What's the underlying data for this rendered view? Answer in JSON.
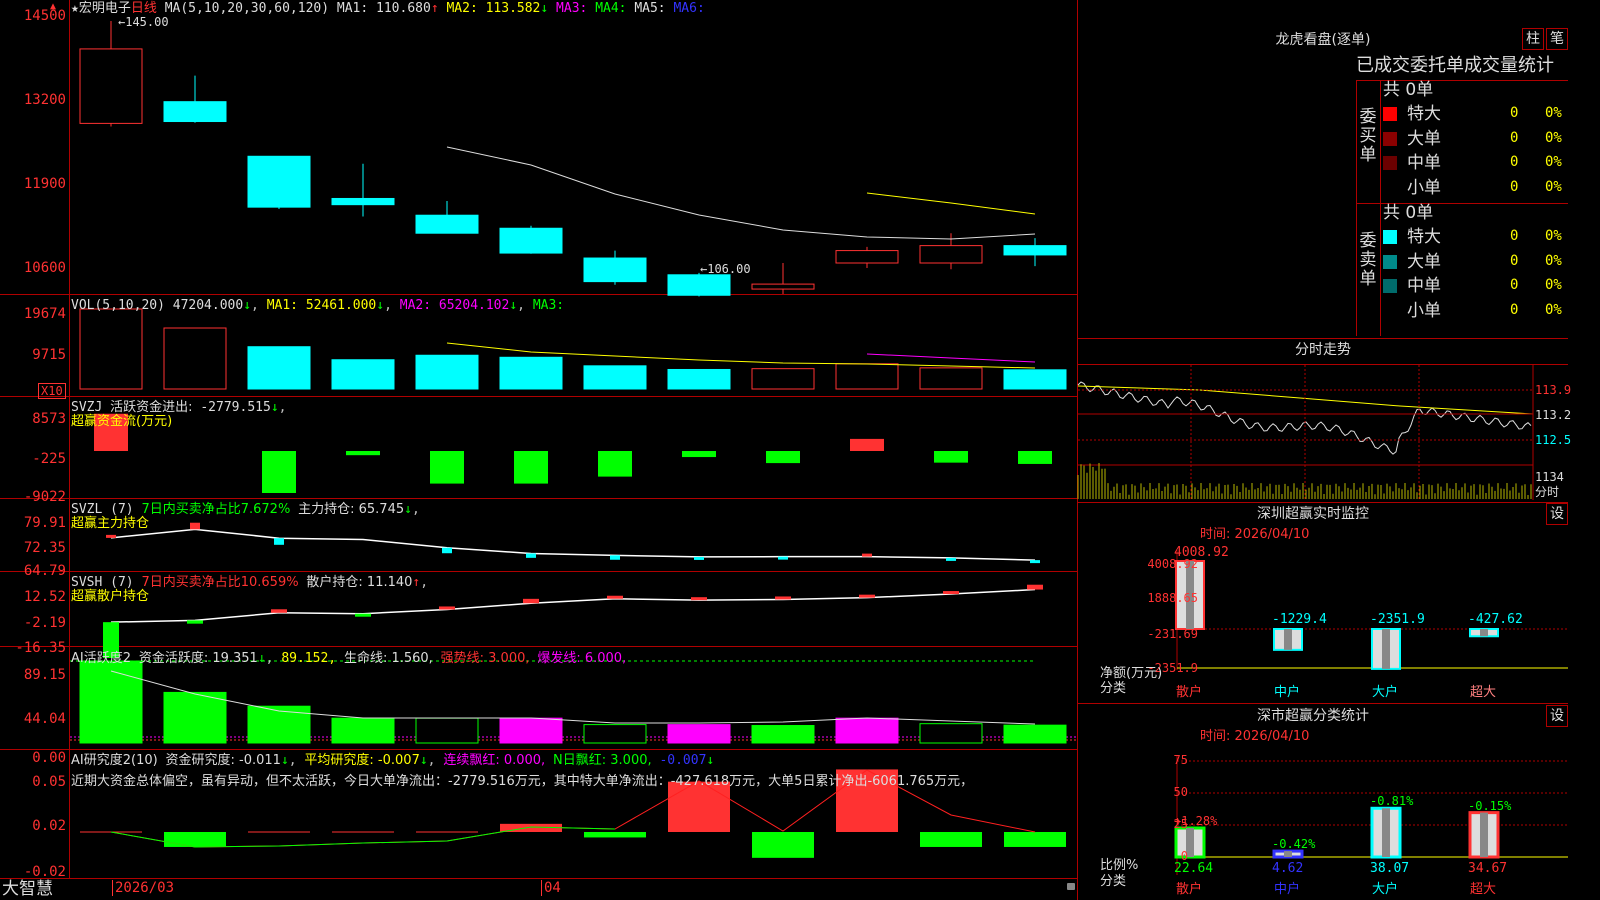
{
  "stock": {
    "star": "★",
    "name": "宏明电子",
    "period": "日线"
  },
  "kline": {
    "ma_label": "MA(5,10,20,30,60,120)",
    "ma1": "MA1: 110.680",
    "ma1_arrow": "↑",
    "ma2": "MA2: 113.582",
    "ma2_arrow": "↓",
    "ma3": "MA3:",
    "ma4": "MA4:",
    "ma5": "MA5:",
    "ma6": "MA6:",
    "high_marker": "145.00",
    "low_marker": "106.00",
    "y_labels": [
      "14500",
      "13200",
      "11900",
      "10600"
    ],
    "candles": [
      {
        "o": 128.5,
        "c": 140.5,
        "h": 145.0,
        "l": 128.0
      },
      {
        "o": 132.0,
        "c": 128.8,
        "h": 136.2,
        "l": 128.6
      },
      {
        "o": 123.2,
        "c": 115.0,
        "h": 123.2,
        "l": 114.7
      },
      {
        "o": 116.4,
        "c": 115.4,
        "h": 122.0,
        "l": 113.5
      },
      {
        "o": 113.7,
        "c": 110.8,
        "h": 116.0,
        "l": 110.8
      },
      {
        "o": 111.6,
        "c": 107.6,
        "h": 112.0,
        "l": 107.5
      },
      {
        "o": 106.8,
        "c": 103.0,
        "h": 108.0,
        "l": 102.5
      },
      {
        "o": 104.1,
        "c": 100.8,
        "h": 104.4,
        "l": 100.6
      },
      {
        "o": 101.8,
        "c": 102.6,
        "h": 106.0,
        "l": 101.0
      },
      {
        "o": 106.0,
        "c": 108.0,
        "h": 108.6,
        "l": 105.2
      },
      {
        "o": 106.0,
        "c": 108.8,
        "h": 110.8,
        "l": 105.0
      },
      {
        "o": 108.8,
        "c": 107.3,
        "h": 110.0,
        "l": 105.5
      }
    ]
  },
  "vol": {
    "label": "VOL(5,10,20)",
    "value": "47204.000",
    "value_arrow": "↓",
    "ma1": "MA1: 52461.000",
    "ma1_arrow": "↓",
    "ma2": "MA2: 65204.102",
    "ma2_arrow": "↓",
    "ma3": "MA3:",
    "y_labels": [
      "19674",
      "9715"
    ],
    "unit": "X10",
    "bars": [
      {
        "v": 19674,
        "up": false
      },
      {
        "v": 15000,
        "up": false
      },
      {
        "v": 10400,
        "up": true
      },
      {
        "v": 7200,
        "up": true
      },
      {
        "v": 8300,
        "up": true
      },
      {
        "v": 7800,
        "up": true
      },
      {
        "v": 5700,
        "up": true
      },
      {
        "v": 4800,
        "up": true
      },
      {
        "v": 5000,
        "up": false
      },
      {
        "v": 6200,
        "up": false
      },
      {
        "v": 5200,
        "up": false
      },
      {
        "v": 4720,
        "up": true
      }
    ]
  },
  "svzj": {
    "label": "SVZJ",
    "desc": "活跃资金进出:",
    "value": "-2779.515",
    "arrow": "↓",
    "sub": "超赢资金流(万元)",
    "y_labels": [
      "8573",
      "-225",
      "-9022"
    ],
    "values": [
      8000,
      0,
      -9022,
      -900,
      -7000,
      -7000,
      -5500,
      -1300,
      -2600,
      2600,
      -2500,
      -2779
    ]
  },
  "svzl": {
    "label": "SVZL",
    "period": "(7)",
    "desc": "7日内买卖净占比7.672%",
    "hold": "主力持仓: 65.745",
    "arrow": "↓",
    "sub": "超赢主力持仓",
    "y_labels": [
      "79.91",
      "72.35",
      "64.79"
    ],
    "line": [
      72.7,
      75.4,
      72.6,
      72.2,
      69.6,
      67.8,
      67.2,
      66.7,
      66.8,
      66.8,
      66.4,
      65.7
    ],
    "bars": [
      {
        "v": 0.4
      },
      {
        "v": 3.0
      },
      {
        "v": -3.0
      },
      {
        "v": 0
      },
      {
        "v": -2.5
      },
      {
        "v": -2.0
      },
      {
        "v": -2.0
      },
      {
        "v": -0.3
      },
      {
        "v": -0.5
      },
      {
        "v": 0.3
      },
      {
        "v": -0.4
      },
      {
        "v": -0.9
      }
    ]
  },
  "svsh": {
    "label": "SVSH",
    "period": "(7)",
    "desc": "7日内买卖净占比10.659%",
    "hold": "散户持仓: 11.140",
    "arrow": "↑",
    "sub": "超赢散户持仓",
    "y_labels": [
      "12.52",
      "-2.19",
      "-16.35"
    ],
    "line": [
      -7.0,
      -6.0,
      -1.8,
      -2.3,
      0.0,
      3.5,
      6.0,
      5.2,
      5.6,
      6.6,
      8.6,
      11.1
    ],
    "bars": [
      {
        "v": -16.3
      },
      {
        "v": -1.5
      },
      {
        "v": 1.6
      },
      {
        "v": -0.5
      },
      {
        "v": 1.4
      },
      {
        "v": 2.0
      },
      {
        "v": 1.3
      },
      {
        "v": 0.5
      },
      {
        "v": 0.3
      },
      {
        "v": 0.4
      },
      {
        "v": 1.0
      },
      {
        "v": 2.2
      }
    ]
  },
  "ai2": {
    "label": "AI活跃度2",
    "desc": "资金活跃度: 19.351",
    "arrow": "↓",
    "v2": "89.152,",
    "v3": "生命线: 1.560,",
    "v4": "强势线: 3.000,",
    "v5": "爆发线: 6.000,",
    "y_labels": [
      "89.15",
      "44.04",
      "0.00"
    ],
    "bars": [
      {
        "v": 89.1,
        "c": "g"
      },
      {
        "v": 55.0,
        "c": "g"
      },
      {
        "v": 40.0,
        "c": "g"
      },
      {
        "v": 27.0,
        "c": "g"
      },
      {
        "v": 27.0,
        "c": "go"
      },
      {
        "v": 27.0,
        "c": "m"
      },
      {
        "v": 20.0,
        "c": "go"
      },
      {
        "v": 20.0,
        "c": "m"
      },
      {
        "v": 19.0,
        "c": "g"
      },
      {
        "v": 27.0,
        "c": "m"
      },
      {
        "v": 21.0,
        "c": "go"
      },
      {
        "v": 19.4,
        "c": "g"
      }
    ]
  },
  "ai_research": {
    "label": "AI研究度2(10)",
    "desc": "资金研究度: -0.011",
    "arrow": "↓",
    "v2": "平均研究度: -0.007",
    "v2_arrow": "↓",
    "v3": "连续飘红: 0.000,",
    "v4": "N日飘红: 3.000,",
    "v5": "-0.007",
    "v5_arrow": "↓",
    "comment": "近期大资金总体偏空，虽有异动，但不太活跃，今日大单净流出：-2779.516万元，其中特大单净流出：-427.618万元，大单5日累计净出-6061.765万元，",
    "y_labels": [
      "0.05",
      "0.02",
      "-0.02"
    ],
    "values": [
      0,
      -0.011,
      0,
      0,
      0,
      0.006,
      -0.004,
      0.037,
      -0.019,
      0.046,
      -0.011,
      -0.011
    ],
    "line": [
      0,
      -0.017,
      -0.016,
      -0.015,
      -0.012,
      -0.005,
      0.0,
      0.037,
      0.0,
      0.046,
      0.012,
      0.0
    ]
  },
  "xaxis": {
    "labels": [
      "2026/03",
      "04"
    ]
  },
  "brand": "大智慧",
  "panel": {
    "dragon_title": "龙虎看盘(逐单)",
    "btn_bar": "柱",
    "btn_pen": "笔",
    "stat_title": "已成交委托单成交量统计",
    "buy": {
      "side": "委买单",
      "total": "共 0单",
      "rows": [
        {
          "name": "特大",
          "n": "0",
          "p": "0%",
          "color": "#ff0000"
        },
        {
          "name": "大单",
          "n": "0",
          "p": "0%",
          "color": "#8b0000"
        },
        {
          "name": "中单",
          "n": "0",
          "p": "0%",
          "color": "#6b0000"
        },
        {
          "name": "小单",
          "n": "0",
          "p": "0%",
          "color": ""
        }
      ]
    },
    "sell": {
      "side": "委卖单",
      "total": "共 0单",
      "rows": [
        {
          "name": "特大",
          "n": "0",
          "p": "0%",
          "color": "#00ffff"
        },
        {
          "name": "大单",
          "n": "0",
          "p": "0%",
          "color": "#008b8b"
        },
        {
          "name": "中单",
          "n": "0",
          "p": "0%",
          "color": "#006b6b"
        },
        {
          "name": "小单",
          "n": "0",
          "p": "0%",
          "color": ""
        }
      ]
    },
    "fenshi": {
      "title": "分时走势",
      "labels": [
        "113.9",
        "113.2",
        "112.5",
        "1134"
      ],
      "unit": "分时"
    },
    "monitor": {
      "title": "深圳超赢实时监控",
      "btn": "设",
      "time": "时间: 2026/04/10",
      "y_labels": [
        "4008.92",
        "1888.65",
        "-231.69",
        "-2351.9"
      ],
      "ylabel": "净额(万元)",
      "xlabel": "分类",
      "cats": [
        "散户",
        "中户",
        "大户",
        "超大"
      ],
      "values": [
        {
          "label": "4008.92",
          "v": 4008.92
        },
        {
          "label": "-1229.4",
          "v": -1229.4
        },
        {
          "label": "-2351.9",
          "v": -2351.9
        },
        {
          "label": "-427.62",
          "v": -427.62
        }
      ]
    },
    "classify": {
      "title": "深市超赢分类统计",
      "btn": "设",
      "time": "时间: 2026/04/10",
      "y_labels": [
        "75",
        "50",
        "25",
        "0"
      ],
      "ylabel": "比例%",
      "xlabel": "分类",
      "cats": [
        "散户",
        "中户",
        "大户",
        "超大"
      ],
      "pct": [
        "+1.28%",
        "-0.42%",
        "-0.81%",
        "-0.15%"
      ],
      "values": [
        {
          "label": "22.64",
          "v": 22.64
        },
        {
          "label": "4.62",
          "v": 4.62
        },
        {
          "label": "38.07",
          "v": 38.07
        },
        {
          "label": "34.67",
          "v": 34.67
        }
      ]
    }
  }
}
